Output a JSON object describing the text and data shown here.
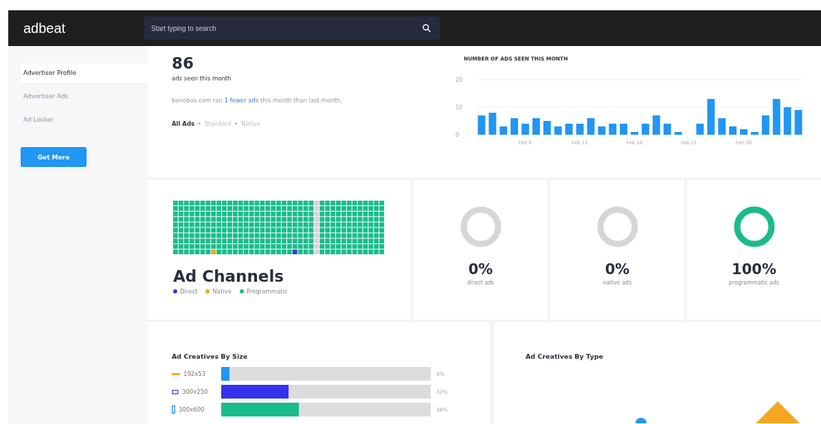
{
  "header": {
    "logo": "adbeat",
    "search": {
      "placeholder": "Start typing to search"
    }
  },
  "sidebar": {
    "items": [
      {
        "label": "Advertiser Profile",
        "selected": true
      },
      {
        "label": "Advertiser Ads",
        "selected": false
      },
      {
        "label": "Ad Locker",
        "selected": false
      }
    ],
    "button": "Get More"
  },
  "summary": {
    "count": "86",
    "caption": "ads seen this month",
    "sentence": {
      "before": "bonobos.com ran",
      "link": "1 fewer ads",
      "after": "this month than last month."
    },
    "filters": [
      {
        "label": "All Ads",
        "selected": true
      },
      {
        "label": "Standard",
        "selected": false
      },
      {
        "label": "Native",
        "selected": false
      }
    ],
    "separator": "•"
  },
  "ads_chart": {
    "chart_data": {
      "type": "bar",
      "title": "NUMBER OF ADS SEEN THIS MONTH",
      "categories": [
        null,
        null,
        null,
        null,
        "Feb 6",
        null,
        null,
        null,
        null,
        "Feb 11",
        null,
        null,
        null,
        null,
        "Feb 16",
        null,
        null,
        null,
        null,
        "Feb 21",
        null,
        null,
        null,
        null,
        "Feb 26",
        null,
        null,
        null,
        null,
        null
      ],
      "values": [
        7,
        8,
        3,
        6,
        4,
        6,
        5,
        3,
        4,
        4,
        6,
        3,
        4,
        4,
        1,
        4,
        7,
        4,
        1,
        0,
        4,
        13,
        6,
        3,
        2,
        1,
        7,
        13,
        10,
        9
      ],
      "ylim": [
        0,
        20
      ],
      "yticks": [
        0,
        10,
        20
      ]
    }
  },
  "channels": {
    "title": "Ad Channels",
    "legend": [
      {
        "label": "Direct",
        "color": "#3b3bd6"
      },
      {
        "label": "Native",
        "color": "#f5a623"
      },
      {
        "label": "Programmatic",
        "color": "#1abc8c"
      }
    ],
    "stats": [
      {
        "value": "0%",
        "caption": "direct ads",
        "level": 0
      },
      {
        "value": "0%",
        "caption": "native ads",
        "level": 0
      },
      {
        "value": "100%",
        "caption": "programmatic ads",
        "level": 1
      }
    ]
  },
  "by_size": {
    "title": "Ad Creatives By Size",
    "rows": [
      {
        "kind": "line",
        "label": "192x53",
        "level": 0.04,
        "percent": "4%",
        "color": "#2196f3"
      },
      {
        "kind": "box",
        "label": "300x250",
        "level": 0.32,
        "percent": "32%",
        "color": "#3333ee"
      },
      {
        "kind": "tall",
        "label": "300x600",
        "level": 0.37,
        "percent": "38%",
        "color": "#1abc8c"
      }
    ]
  },
  "by_type": {
    "title": "Ad Creatives By Type"
  }
}
